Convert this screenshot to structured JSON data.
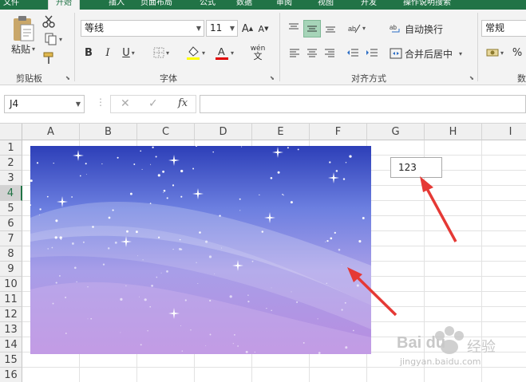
{
  "tabs": {
    "file": "文件",
    "home": "开始",
    "insert": "插入",
    "layout": "页面布局",
    "formulas": "公式",
    "data": "数据",
    "review": "审阅",
    "view": "视图",
    "dev": "开发",
    "tellme": "操作说明搜索"
  },
  "ribbon": {
    "clipboard": {
      "label": "剪贴板",
      "paste": "粘贴"
    },
    "font": {
      "label": "字体",
      "name": "等线",
      "size": "11",
      "bold": "B",
      "italic": "I",
      "underline": "U",
      "grow": "A",
      "shrink": "A",
      "fontcolor": "A",
      "phonetic": "wén"
    },
    "alignment": {
      "label": "对齐方式",
      "wrap": "自动换行",
      "merge": "合并后居中"
    },
    "number": {
      "label": "数",
      "format": "常规",
      "percent": "%"
    }
  },
  "formula_bar": {
    "name_box": "J4",
    "cancel": "✕",
    "enter": "✓",
    "fx": "fx",
    "value": ""
  },
  "grid": {
    "columns": [
      "A",
      "B",
      "C",
      "D",
      "E",
      "F",
      "G",
      "H",
      "I"
    ],
    "rows": [
      "1",
      "2",
      "3",
      "4",
      "5",
      "6",
      "7",
      "8",
      "9",
      "10",
      "11",
      "12",
      "13",
      "14",
      "15",
      "16"
    ],
    "selected_row": "4"
  },
  "textbox": {
    "value": "123"
  },
  "watermark": {
    "brand": "Bai du",
    "label": "经验",
    "url": "jingyan.baidu.com"
  },
  "colors": {
    "excel_green": "#217346",
    "arrow_red": "#e53935",
    "align_active": "#a6d4b8"
  }
}
